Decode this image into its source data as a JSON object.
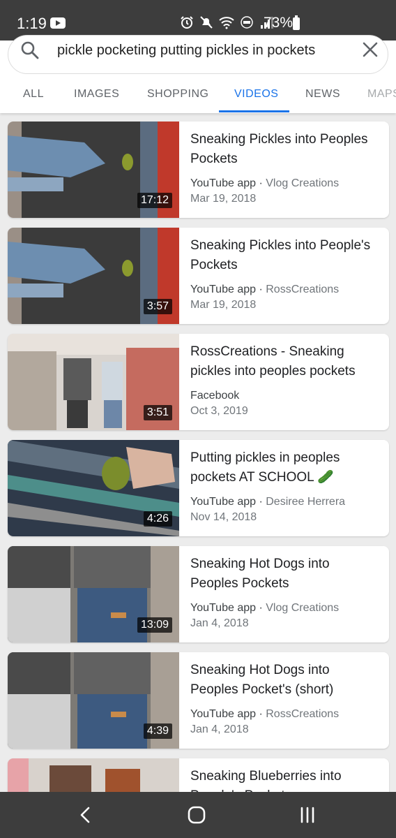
{
  "status": {
    "time": "1:19",
    "battery": "73%"
  },
  "search": {
    "query": "pickle pocketing putting pickles in pockets"
  },
  "tabs": [
    "ALL",
    "IMAGES",
    "SHOPPING",
    "VIDEOS",
    "NEWS",
    "MAPS"
  ],
  "active_tab": "VIDEOS",
  "results": [
    {
      "title": "Sneaking Pickles into Peoples Pockets",
      "source": "YouTube app",
      "channel": "Vlog Creations",
      "date": "Mar 19, 2018",
      "duration": "17:12"
    },
    {
      "title": "Sneaking Pickles into People's Pockets",
      "source": "YouTube app",
      "channel": "RossCreations",
      "date": "Mar 19, 2018",
      "duration": "3:57"
    },
    {
      "title": "RossCreations - Sneaking pickles into peoples pockets",
      "source": "Facebook",
      "channel": "",
      "date": "Oct 3, 2019",
      "duration": "3:51"
    },
    {
      "title": "Putting pickles in peoples pockets AT SCHOOL 🥒",
      "source": "YouTube app",
      "channel": "Desiree Herrera",
      "date": "Nov 14, 2018",
      "duration": "4:26"
    },
    {
      "title": "Sneaking Hot Dogs into Peoples Pockets",
      "source": "YouTube app",
      "channel": "Vlog Creations",
      "date": "Jan 4, 2018",
      "duration": "13:09"
    },
    {
      "title": "Sneaking Hot Dogs into Peoples Pocket's (short)",
      "source": "YouTube app",
      "channel": "RossCreations",
      "date": "Jan 4, 2018",
      "duration": "4:39"
    },
    {
      "title": "Sneaking Blueberries into People's Pocket",
      "source": "",
      "channel": "",
      "date": "",
      "duration": ""
    }
  ],
  "colors": {
    "accent": "#1a73e8",
    "status_bar": "#3d3d3d",
    "background": "#ececec"
  },
  "icons": {
    "search": "search-icon",
    "clear": "close-icon",
    "back": "back-icon",
    "home": "home-icon",
    "recents": "recents-icon"
  }
}
